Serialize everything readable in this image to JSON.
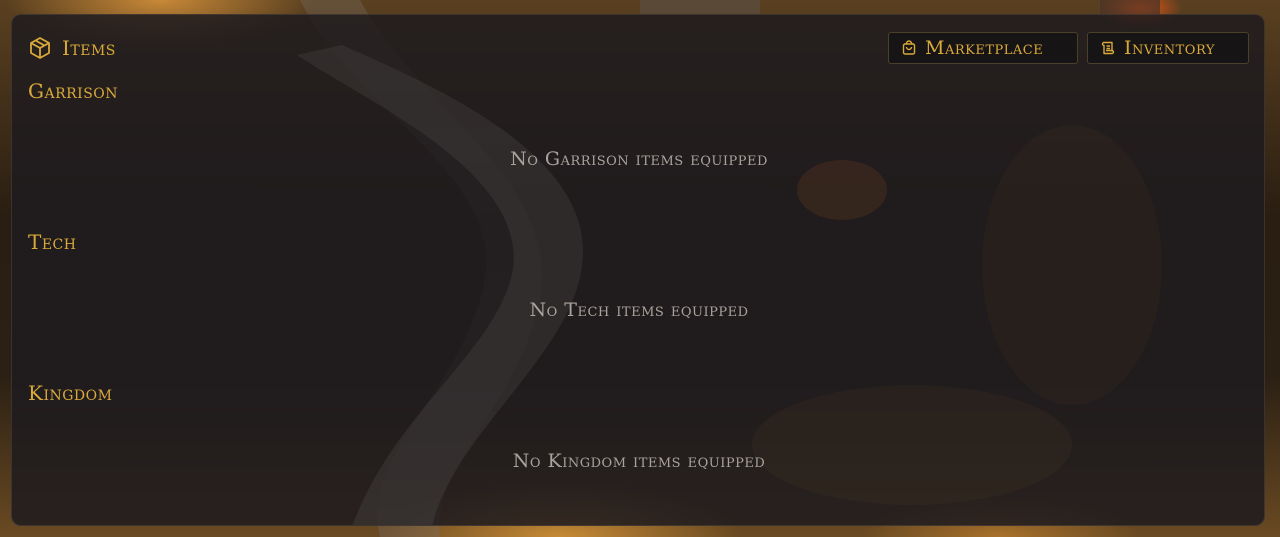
{
  "panel": {
    "title": "Items",
    "title_icon": "cube-icon"
  },
  "header_buttons": {
    "marketplace": {
      "label": "Marketplace",
      "icon": "shopping-bag-icon"
    },
    "inventory": {
      "label": "Inventory",
      "icon": "scroll-icon"
    }
  },
  "sections": [
    {
      "title": "Garrison",
      "empty_text": "No Garrison items equipped"
    },
    {
      "title": "Tech",
      "empty_text": "No Tech items equipped"
    },
    {
      "title": "Kingdom",
      "empty_text": "No Kingdom items equipped"
    }
  ],
  "colors": {
    "accent": "#d9a93a",
    "panel_bg": "#1e1b1e",
    "muted_text": "#a8a39c"
  }
}
